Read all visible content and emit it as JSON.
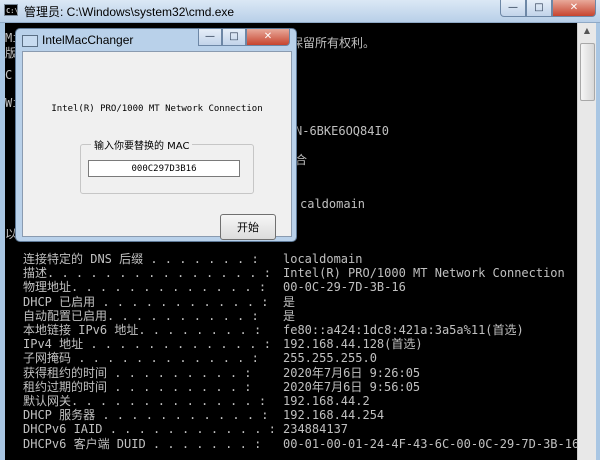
{
  "cmd": {
    "title": "管理员: C:\\Windows\\system32\\cmd.exe",
    "icon_text": "C:\\",
    "window_controls": {
      "minimize": "—",
      "maximize": "□",
      "close": "✕"
    },
    "fragments": {
      "mi": "Mi",
      "ban": "版",
      "c_drive": "C:",
      "wi": "Wi",
      "yi": "以",
      "rights": "保留所有权利。",
      "host_partial": "N-6BKE6OQ84I0",
      "he": "合",
      "dns_partial": "caldomain"
    },
    "rows": [
      {
        "label": "连接特定的 DNS 后缀 . . . . . . . :",
        "value": "localdomain"
      },
      {
        "label": "描述. . . . . . . . . . . . . . . :",
        "value": "Intel(R) PRO/1000 MT Network Connection"
      },
      {
        "label": "物理地址. . . . . . . . . . . . . :",
        "value": "00-0C-29-7D-3B-16"
      },
      {
        "label": "DHCP 已启用 . . . . . . . . . . . :",
        "value": "是"
      },
      {
        "label": "自动配置已启用. . . . . . . . . . :",
        "value": "是"
      },
      {
        "label": "本地链接 IPv6 地址. . . . . . . . :",
        "value": "fe80::a424:1dc8:421a:3a5a%11(首选)"
      },
      {
        "label": "IPv4 地址 . . . . . . . . . . . . :",
        "value": "192.168.44.128(首选)"
      },
      {
        "label": "子网掩码 . . . . . . . . . . . . :",
        "value": "255.255.255.0"
      },
      {
        "label": "获得租约的时间 . . . . . . . . . :",
        "value": "2020年7月6日 9:26:05"
      },
      {
        "label": "租约过期的时间 . . . . . . . . . :",
        "value": "2020年7月6日 9:56:05"
      },
      {
        "label": "默认网关. . . . . . . . . . . . . :",
        "value": "192.168.44.2"
      },
      {
        "label": "DHCP 服务器 . . . . . . . . . . . :",
        "value": "192.168.44.254"
      },
      {
        "label": "DHCPv6 IAID . . . . . . . . . . . :",
        "value": "234884137"
      },
      {
        "label": "DHCPv6 客户端 DUID . . . . . . . :",
        "value": "00-01-00-01-24-4F-43-6C-00-0C-29-7D-3B-16"
      }
    ]
  },
  "dialog": {
    "title": "IntelMacChanger",
    "window_controls": {
      "minimize": "—",
      "maximize": "□",
      "close": "✕"
    },
    "adapter_name": "Intel(R) PRO/1000 MT Network Connection",
    "group_label": "输入你要替换的 MAC",
    "mac_value": "000C297D3B16",
    "start_label": "开始"
  },
  "colors": {
    "console_bg": "#000000",
    "console_text": "#c0c0c0",
    "dialog_frame": "#b9d1ea",
    "close_button": "#c7442f"
  },
  "icons": [
    "cmd-app-icon",
    "app-window-icon"
  ]
}
